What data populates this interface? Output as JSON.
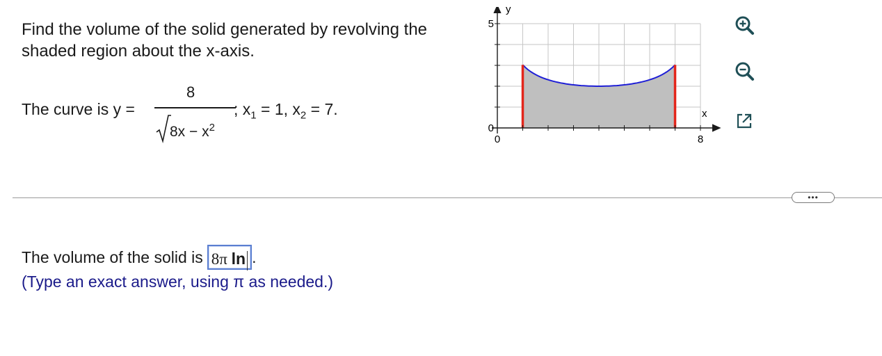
{
  "question": {
    "prompt": "Find the volume of the solid generated by revolving the shaded region about the x-axis.",
    "curve_label": "The curve is y =",
    "numerator": "8",
    "radicand_base": "8x − x",
    "radicand_exponent": "2",
    "bounds_prefix": "; x",
    "x1_sub": "1",
    "x1_value": " = 1, x",
    "x2_sub": "2",
    "x2_value": " = 7."
  },
  "graph": {
    "y_axis_label": "y",
    "x_axis_label": "x",
    "y_tick_5": "5",
    "y_tick_0": "0",
    "x_tick_0": "0",
    "x_tick_8": "8",
    "xlim": [
      0,
      8
    ],
    "ylim": [
      0,
      5
    ],
    "x_bounds": [
      1,
      7
    ],
    "curve_color": "#1f1fd6",
    "bound_color": "#e3261b",
    "shade_color": "#bfbfbf"
  },
  "tools": {
    "zoom_in": "zoom-in-icon",
    "zoom_out": "zoom-out-icon",
    "popout": "popout-icon"
  },
  "more_button_label": "•••",
  "answer": {
    "label": "The volume of the solid is",
    "value_prefix": "8π",
    "value_bold": "ln",
    "end": ".",
    "hint": "(Type an exact answer, using π as needed.)"
  }
}
